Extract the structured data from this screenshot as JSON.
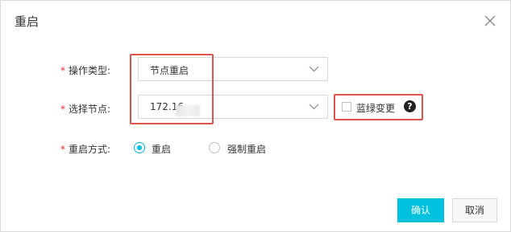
{
  "dialog": {
    "title": "重启",
    "close_icon": "close-icon"
  },
  "form": {
    "operation_type": {
      "required_mark": "*",
      "label": "操作类型:",
      "value": "节点重启"
    },
    "select_node": {
      "required_mark": "*",
      "label": "选择节点:",
      "value": "172.16"
    },
    "blue_green": {
      "label": "蓝绿变更",
      "checked": false,
      "help_icon": "?"
    },
    "restart_method": {
      "required_mark": "*",
      "label": "重启方式:",
      "options": [
        {
          "label": "重启",
          "selected": true
        },
        {
          "label": "强制重启",
          "selected": false
        }
      ]
    }
  },
  "buttons": {
    "confirm": "确认",
    "cancel": "取消"
  },
  "colors": {
    "accent": "#00c1de",
    "highlight": "#e2534c",
    "required": "#f5222d"
  }
}
